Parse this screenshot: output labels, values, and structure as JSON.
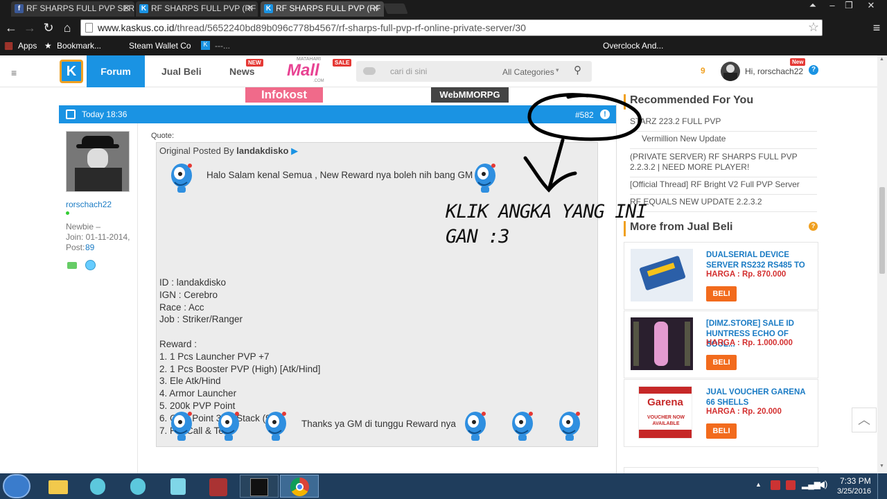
{
  "tabs": [
    {
      "title": "RF SHARPS FULL PVP SER",
      "favicon": "facebook-icon",
      "color": "#3b5998",
      "letter": "f"
    },
    {
      "title": "RF SHARPS FULL PVP (RF",
      "favicon": "kaskus-icon",
      "color": "#1a93e3",
      "letter": "K"
    },
    {
      "title": "RF SHARPS FULL PVP (RF",
      "favicon": "kaskus-icon",
      "color": "#1a93e3",
      "letter": "K"
    }
  ],
  "url": {
    "domain": "www.kaskus.co.id",
    "path": "/thread/5652240bd89b096c778b4567/rf-sharps-full-pvp-rf-online-private-server/30"
  },
  "bookmarks": {
    "apps": "Apps",
    "bookmarks": "Bookmark...",
    "steam": "Steam Wallet Co",
    "kaskus": "---...",
    "overclock": "Overclock And..."
  },
  "nav": {
    "forum": "Forum",
    "jual_beli": "Jual Beli",
    "news": "News",
    "news_badge": "NEW",
    "mall_top": "MATAHARI",
    "mall": "Mall",
    "mall_sub": ".COM",
    "mall_badge": "SALE",
    "search_placeholder": "cari di sini",
    "category": "All Categories",
    "notif_count": "9",
    "greeting": "Hi, rorschach22",
    "user_badge": "New"
  },
  "banners": {
    "left": "Infokost",
    "right": "WebMMORPG"
  },
  "post": {
    "time": "Today 18:36",
    "number": "#582",
    "quote_label": "Quote:",
    "original_posted_by": "Original Posted By",
    "original_author": "landakdisko",
    "greeting": "Halo Salam kenal Semua , New Reward nya boleh nih bang GM",
    "details": [
      "ID : landakdisko",
      "IGN : Cerebro",
      "Race : Acc",
      "Job : Striker/Ranger"
    ],
    "reward_header": "Reward :",
    "rewards": [
      "1. 1 Pcs Launcher PVP +7",
      "2. 1 Pcs Booster PVP (High) [Atk/Hind]",
      "3. Ele Atk/Hind",
      "4. Armor Launcher",
      "5. 200k PVP Point",
      "6. Gold Point 3k 3 Stack (99)",
      "7. Pot Call & Tele"
    ],
    "thanks": "Thanks ya GM di tunggu Reward nya"
  },
  "user": {
    "name": "rorschach22",
    "rank": "Newbie –",
    "join": "Join: 01-11-2014,",
    "post_label": "Post:",
    "post_count": "89"
  },
  "annotation": {
    "line1": "KLIK ANGKA YANG INI",
    "line2": "GAN :3"
  },
  "sidebar": {
    "recommended_title": "Recommended For You",
    "recommended": [
      "STARZ 223.2 FULL PVP",
      "Vermillion New Update",
      "(PRIVATE SERVER) RF SHARPS FULL PVP 2.2.3.2 | NEED MORE PLAYER!",
      "[Official Thread] RF Bright V2 Full PVP Server",
      "RF EQUALS NEW UPDATE 2.2.3.2"
    ],
    "more_title": "More from Jual Beli",
    "products": [
      {
        "title": "DUALSERIAL DEVICE SERVER RS232 RS485 TO",
        "price": "HARGA : Rp. 870.000",
        "buy": "BELI"
      },
      {
        "title": "[DIMZ.STORE] SALE ID HUNTRESS ECHO OF SOUL...",
        "price": "HARGA : Rp. 1.000.000",
        "buy": "BELI"
      },
      {
        "title": "JUAL VOUCHER GARENA 66 SHELLS",
        "price": "HARGA : Rp. 20.000",
        "buy": "BELI",
        "img_text": "Garena",
        "img_sub": "VOUCHER NOW AVAILABLE"
      }
    ]
  },
  "taskbar": {
    "time": "7:33 PM",
    "date": "3/25/2016"
  },
  "colors": {
    "kaskus_blue": "#1a93e3",
    "buy_orange": "#f26b1d",
    "price_red": "#d32f2f"
  }
}
